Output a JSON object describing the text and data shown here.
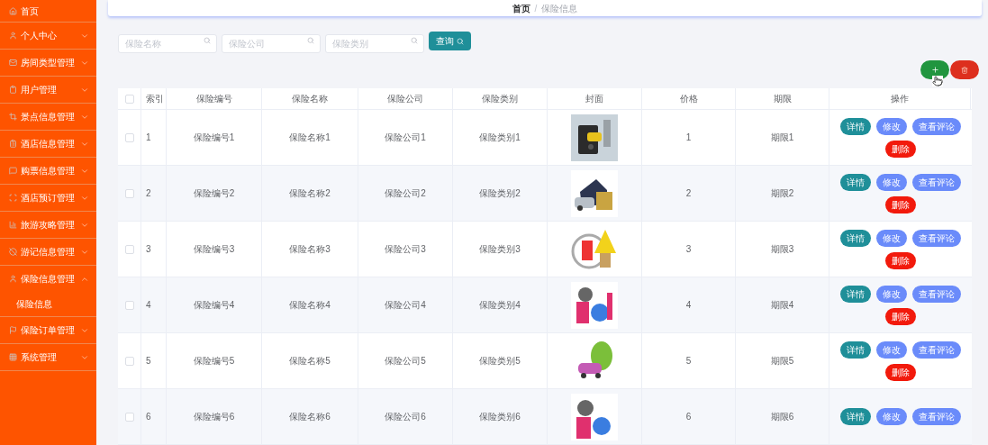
{
  "sidebar": {
    "items": [
      {
        "label": "首页",
        "expandable": false
      },
      {
        "label": "个人中心",
        "expandable": true,
        "expanded": false
      },
      {
        "label": "房间类型管理",
        "expandable": true,
        "expanded": false
      },
      {
        "label": "用户管理",
        "expandable": true,
        "expanded": false
      },
      {
        "label": "景点信息管理",
        "expandable": true,
        "expanded": false
      },
      {
        "label": "酒店信息管理",
        "expandable": true,
        "expanded": false
      },
      {
        "label": "购票信息管理",
        "expandable": true,
        "expanded": false
      },
      {
        "label": "酒店预订管理",
        "expandable": true,
        "expanded": false
      },
      {
        "label": "旅游攻略管理",
        "expandable": true,
        "expanded": false
      },
      {
        "label": "游记信息管理",
        "expandable": true,
        "expanded": false
      },
      {
        "label": "保险信息管理",
        "expandable": true,
        "expanded": true,
        "children": [
          {
            "label": "保险信息"
          }
        ]
      },
      {
        "label": "保险订单管理",
        "expandable": true,
        "expanded": false
      },
      {
        "label": "系统管理",
        "expandable": true,
        "expanded": false
      }
    ]
  },
  "breadcrumb": {
    "items": [
      "首页",
      "保险信息"
    ],
    "separator": "/"
  },
  "search": {
    "fields": [
      {
        "placeholder": "保险名称"
      },
      {
        "placeholder": "保险公司"
      },
      {
        "placeholder": "保险类别"
      }
    ],
    "button": "查询"
  },
  "table": {
    "select_all": {
      "checked": false
    },
    "columns": [
      "索引",
      "保险编号",
      "保险名称",
      "保险公司",
      "保险类别",
      "封面",
      "价格",
      "期限",
      "操作"
    ],
    "rows": [
      {
        "checked": false,
        "cells": [
          "1",
          "保险编号1",
          "保险名称1",
          "保险公司1",
          "保险类别1"
        ],
        "cover": {
          "kind": "picture"
        },
        "price": "1",
        "term": "期限1",
        "actions": [
          {
            "label": "详情",
            "kind": "detail"
          },
          {
            "label": "修改",
            "kind": "edit"
          },
          {
            "label": "查看评论",
            "kind": "comments"
          },
          {
            "label": "删除",
            "kind": "delete"
          }
        ]
      },
      {
        "checked": false,
        "cells": [
          "2",
          "保险编号2",
          "保险名称2",
          "保险公司2",
          "保险类别2"
        ],
        "cover": {
          "kind": "picture"
        },
        "price": "2",
        "term": "期限2",
        "actions": [
          {
            "label": "详情",
            "kind": "detail"
          },
          {
            "label": "修改",
            "kind": "edit"
          },
          {
            "label": "查看评论",
            "kind": "comments"
          },
          {
            "label": "删除",
            "kind": "delete"
          }
        ]
      },
      {
        "checked": false,
        "cells": [
          "3",
          "保险编号3",
          "保险名称3",
          "保险公司3",
          "保险类别3"
        ],
        "cover": {
          "kind": "picture"
        },
        "price": "3",
        "term": "期限3",
        "actions": [
          {
            "label": "详情",
            "kind": "detail"
          },
          {
            "label": "修改",
            "kind": "edit"
          },
          {
            "label": "查看评论",
            "kind": "comments"
          },
          {
            "label": "删除",
            "kind": "delete"
          }
        ]
      },
      {
        "checked": false,
        "cells": [
          "4",
          "保险编号4",
          "保险名称4",
          "保险公司4",
          "保险类别4"
        ],
        "cover": {
          "kind": "picture"
        },
        "price": "4",
        "term": "期限4",
        "actions": [
          {
            "label": "详情",
            "kind": "detail"
          },
          {
            "label": "修改",
            "kind": "edit"
          },
          {
            "label": "查看评论",
            "kind": "comments"
          },
          {
            "label": "删除",
            "kind": "delete"
          }
        ]
      },
      {
        "checked": false,
        "cells": [
          "5",
          "保险编号5",
          "保险名称5",
          "保险公司5",
          "保险类别5"
        ],
        "cover": {
          "kind": "picture"
        },
        "price": "5",
        "term": "期限5",
        "actions": [
          {
            "label": "详情",
            "kind": "detail"
          },
          {
            "label": "修改",
            "kind": "edit"
          },
          {
            "label": "查看评论",
            "kind": "comments"
          },
          {
            "label": "删除",
            "kind": "delete"
          }
        ]
      },
      {
        "checked": false,
        "cells": [
          "6",
          "保险编号6",
          "保险名称6",
          "保险公司6",
          "保险类别6"
        ],
        "cover": {
          "kind": "picture"
        },
        "price": "6",
        "term": "期限6",
        "actions": [
          {
            "label": "详情",
            "kind": "detail"
          },
          {
            "label": "修改",
            "kind": "edit"
          },
          {
            "label": "查看评论",
            "kind": "comments"
          }
        ]
      }
    ]
  }
}
